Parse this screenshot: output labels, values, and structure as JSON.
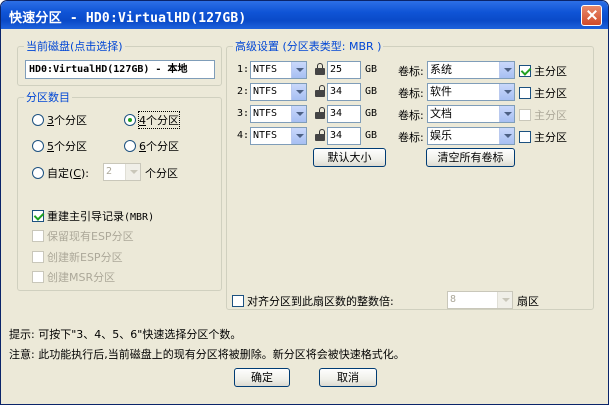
{
  "window": {
    "title": "快速分区 - HD0:VirtualHD(127GB)"
  },
  "disk": {
    "group_title": "当前磁盘(点击选择)",
    "value": "HD0:VirtualHD(127GB) - 本地"
  },
  "partition_count": {
    "group_title": "分区数目",
    "options": [
      {
        "key": "3",
        "rest": "个分区",
        "selected": false
      },
      {
        "key": "4",
        "rest": "个分区",
        "selected": true
      },
      {
        "key": "5",
        "rest": "个分区",
        "selected": false
      },
      {
        "key": "6",
        "rest": "个分区",
        "selected": false
      }
    ],
    "custom": {
      "label": "自定(",
      "key": "C",
      "end": "):",
      "value": "2",
      "suffix": "个分区"
    }
  },
  "options": {
    "rebuild_mbr": {
      "label": "重建主引导记录",
      "suffix": "(MBR)",
      "checked": true
    },
    "keep_esp": {
      "label": "保留现有ESP分区"
    },
    "create_esp": {
      "label": "创建新ESP分区"
    },
    "create_msr": {
      "label": "创建MSR分区"
    }
  },
  "advanced": {
    "group_title": "高级设置 (分区表类型: MBR )",
    "unit": "GB",
    "volume_label": "卷标:",
    "primary_label": "主分区",
    "rows": [
      {
        "index": "1:",
        "fs": "NTFS",
        "size": "25",
        "label": "系统",
        "primary": true,
        "primary_enabled": true
      },
      {
        "index": "2:",
        "fs": "NTFS",
        "size": "34",
        "label": "软件",
        "primary": false,
        "primary_enabled": true
      },
      {
        "index": "3:",
        "fs": "NTFS",
        "size": "34",
        "label": "文档",
        "primary": false,
        "primary_enabled": false
      },
      {
        "index": "4:",
        "fs": "NTFS",
        "size": "34",
        "label": "娱乐",
        "primary": false,
        "primary_enabled": true
      }
    ],
    "default_size_button": "默认大小",
    "clear_labels_button": "清空所有卷标",
    "align": {
      "label": "对齐分区到此扇区数的整数倍:",
      "value": "8",
      "suffix": "扇区",
      "checked": false
    }
  },
  "hints": {
    "tip": "提示: 可按下\"3、4、5、6\"快速选择分区个数。",
    "note": "注意: 此功能执行后,当前磁盘上的现有分区将被删除。新分区将会被快速格式化。"
  },
  "footer": {
    "ok_label": "确定",
    "cancel_label": "取消"
  },
  "colors": {
    "accent": "#0046d5",
    "titlebar": "#0a4ac8",
    "dialog_bg": "#ece9d8"
  }
}
